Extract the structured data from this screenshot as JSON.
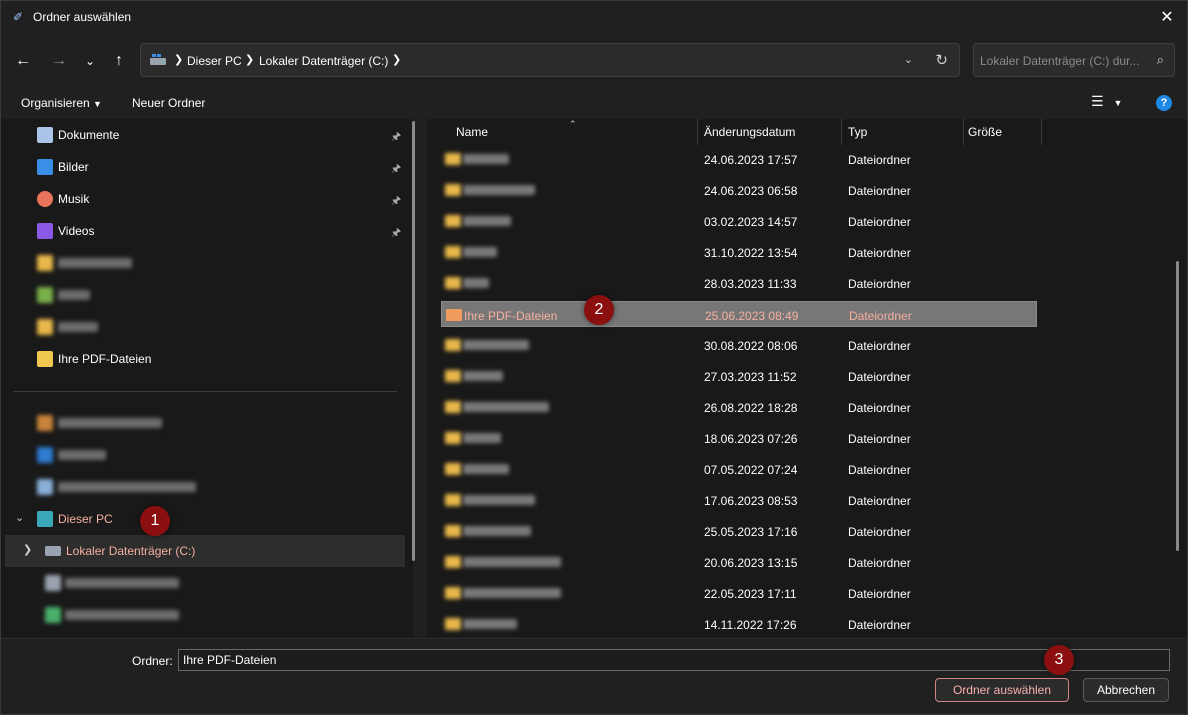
{
  "window": {
    "title": "Ordner auswählen"
  },
  "nav": {
    "breadcrumbs": [
      "Dieser PC",
      "Lokaler Datenträger (C:)"
    ],
    "search_placeholder": "Lokaler Datenträger (C:) dur..."
  },
  "toolbar": {
    "organize_label": "Organisieren",
    "new_folder_label": "Neuer Ordner"
  },
  "sidebar": {
    "quick_access": [
      {
        "label": "Dokumente",
        "icon": "documents-icon",
        "color": "#a9c4e8"
      },
      {
        "label": "Bilder",
        "icon": "pictures-icon",
        "color": "#3a8ee6"
      },
      {
        "label": "Musik",
        "icon": "music-icon",
        "color": "#e8735a"
      },
      {
        "label": "Videos",
        "icon": "videos-icon",
        "color": "#8a5ae6"
      }
    ],
    "pinned_folder": "Ihre PDF-Dateien",
    "this_pc_label": "Dieser PC",
    "drive_label": "Lokaler Datenträger (C:)"
  },
  "file_list": {
    "columns": [
      "Name",
      "Änderungsdatum",
      "Typ",
      "Größe"
    ],
    "rows": [
      {
        "name": "",
        "date": "24.06.2023 17:57",
        "type": "Dateiordner"
      },
      {
        "name": "",
        "date": "24.06.2023 06:58",
        "type": "Dateiordner"
      },
      {
        "name": "",
        "date": "03.02.2023 14:57",
        "type": "Dateiordner"
      },
      {
        "name": "",
        "date": "31.10.2022 13:54",
        "type": "Dateiordner"
      },
      {
        "name": "",
        "date": "28.03.2023 11:33",
        "type": "Dateiordner"
      },
      {
        "name": "Ihre PDF-Dateien",
        "date": "25.06.2023 08:49",
        "type": "Dateiordner",
        "selected": true
      },
      {
        "name": "",
        "date": "30.08.2022 08:06",
        "type": "Dateiordner"
      },
      {
        "name": "",
        "date": "27.03.2023 11:52",
        "type": "Dateiordner"
      },
      {
        "name": "",
        "date": "26.08.2022 18:28",
        "type": "Dateiordner"
      },
      {
        "name": "",
        "date": "18.06.2023 07:26",
        "type": "Dateiordner"
      },
      {
        "name": "",
        "date": "07.05.2022 07:24",
        "type": "Dateiordner"
      },
      {
        "name": "",
        "date": "17.06.2023 08:53",
        "type": "Dateiordner"
      },
      {
        "name": "",
        "date": "25.05.2023 17:16",
        "type": "Dateiordner"
      },
      {
        "name": "",
        "date": "20.06.2023 13:15",
        "type": "Dateiordner"
      },
      {
        "name": "",
        "date": "22.05.2023 17:11",
        "type": "Dateiordner"
      },
      {
        "name": "",
        "date": "14.11.2022 17:26",
        "type": "Dateiordner"
      }
    ]
  },
  "bottom": {
    "folder_label": "Ordner:",
    "folder_value": "Ihre PDF-Dateien",
    "select_button": "Ordner auswählen",
    "cancel_button": "Abbrechen"
  },
  "markers": [
    "1",
    "2",
    "3"
  ],
  "colors": {
    "accent_selected_text": "#f5b0a0",
    "marker": "#8b0f0f",
    "folder": "#e8b84a"
  }
}
